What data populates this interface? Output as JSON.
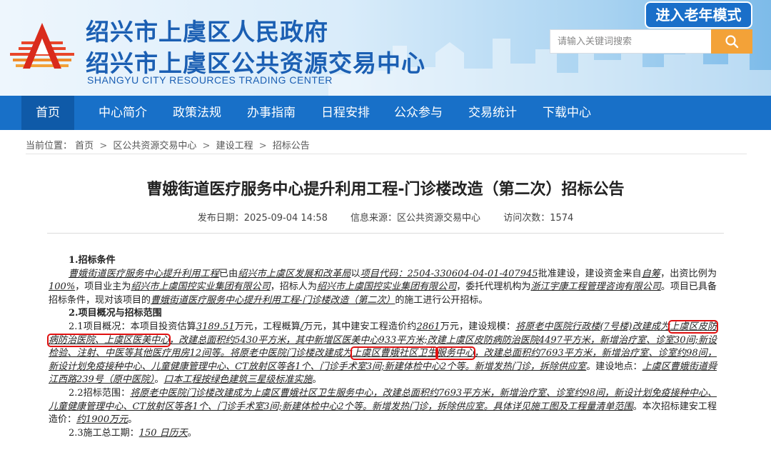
{
  "header": {
    "title_line1": "绍兴市上虞区人民政府",
    "title_line2": "绍兴市上虞区公共资源交易中心",
    "subtitle_en": "SHANGYU CITY RESOURCES TRADING CENTER",
    "elder_mode_label": "进入老年模式",
    "search_placeholder": "请输入关键词搜索",
    "logo_icon": "shangyu-logo-icon",
    "search_icon": "search-icon",
    "colors": {
      "brand_blue": "#1870c8",
      "search_orange": "#f3a238",
      "highlight_red": "#e01010"
    }
  },
  "nav": {
    "items": [
      "首页",
      "中心简介",
      "政策法规",
      "办事指南",
      "日程安排",
      "公众参与",
      "交易统计",
      "下载中心"
    ],
    "active": "首页"
  },
  "breadcrumb": {
    "prefix": "当前位置：",
    "items": [
      "首页",
      "区公共资源交易中心",
      "建设工程",
      "招标公告"
    ],
    "separator": ">"
  },
  "article": {
    "title": "曹娥街道医疗服务中心提升利用工程-门诊楼改造（第二次）招标公告",
    "publish_date_label": "发布日期：",
    "publish_date": "2025-09-04 14:58",
    "source_label": "信息来源：",
    "source": "区公共资源交易中心",
    "views_label": "访问次数：",
    "views": "1574"
  },
  "content": {
    "s1_heading": "1.招标条件",
    "s1_project": "曹娥街道医疗服务中心提升利用工程",
    "s1_t1": "已由",
    "s1_approver": "绍兴市上虞区发展和改革局",
    "s1_t2": "以",
    "s1_code": "项目代码：2504-330604-04-01-407945",
    "s1_t3": "批准建设，建设资金来自",
    "s1_fund": "自筹",
    "s1_t4": "，出资比例为",
    "s1_ratio": "100%",
    "s1_t5": "，项目业主为",
    "s1_owner": "绍兴市上虞国控实业集团有限公司",
    "s1_t6": "，招标人为",
    "s1_tenderer": "绍兴市上虞国控实业集团有限公司",
    "s1_t7": "，委托代理机构为",
    "s1_agency": "浙江宇康工程管理咨询有限公司",
    "s1_t8": "。项目已具备招标条件，现对该项目的",
    "s1_project_full": "曹娥街道医疗服务中心提升利用工程-门诊楼改造（第二次）",
    "s1_t9": "的施工进行公开招标。",
    "s2_heading": "2.项目概况与招标范围",
    "s21_a": "2.1项目概况：本项目投资估算",
    "s21_invest": "3189.51",
    "s21_b": "万元，工程概算",
    "s21_est": "/",
    "s21_c": "万元，其中建安工程造价约",
    "s21_cost": "2861",
    "s21_d": "万元，建设规模：",
    "s21_scale1": "将原老中医院行政楼(7号楼)改建成为",
    "s21_box1": "上虞区皮防病防治医院、上虞区医美中心",
    "s21_scale2": "，改建总面积约5430平方米，其中新增区医美中心933平方米;改建上虞区皮防病防治医院4497平方米，新增治疗室、诊室30间;新设检验、注射、中医等其他医疗用房12间等。将原老中医院门诊楼改建成为",
    "s21_box2a": "上虞区曹娥社区卫生",
    "s21_box2b": "服务中心",
    "s21_scale3": "，改建总面积约7693平方米，新增治疗室、诊室约98间，新设计划免疫接种中心、儿童健康管理中心、CT放射区等各1个、门诊手术室3间;新建体检中心2个等。新增发热门诊，拆除供应室",
    "s21_e": "。建设地点：",
    "s21_site": "上虞区曹娥街道舜江西路239号（原中医院）",
    "s21_f": "。",
    "s21_green": "口本工程按绿色建筑三星级标准实施",
    "s21_g": "。",
    "s22_a": "2.2招标范围：",
    "s22_scope": "将原老中医院门诊楼改建成为上虞区曹娥社区卫生服务中心，改建总面积约7693平方米，新增治疗室、诊室约98间，新设计划免疫接种中心、儿童健康管理中心、CT放射区等各1个、门诊手术室3间;新建体检中心2个等。新增发热门诊，拆除供应室。具体详见施工图及工程量清单范围",
    "s22_b": "。本次招标建安工程造价：",
    "s22_cost": "约1900万元",
    "s22_c": "。",
    "s23_a": "2.3施工总工期：",
    "s23_days": "150 日历天",
    "s23_b": "。"
  }
}
